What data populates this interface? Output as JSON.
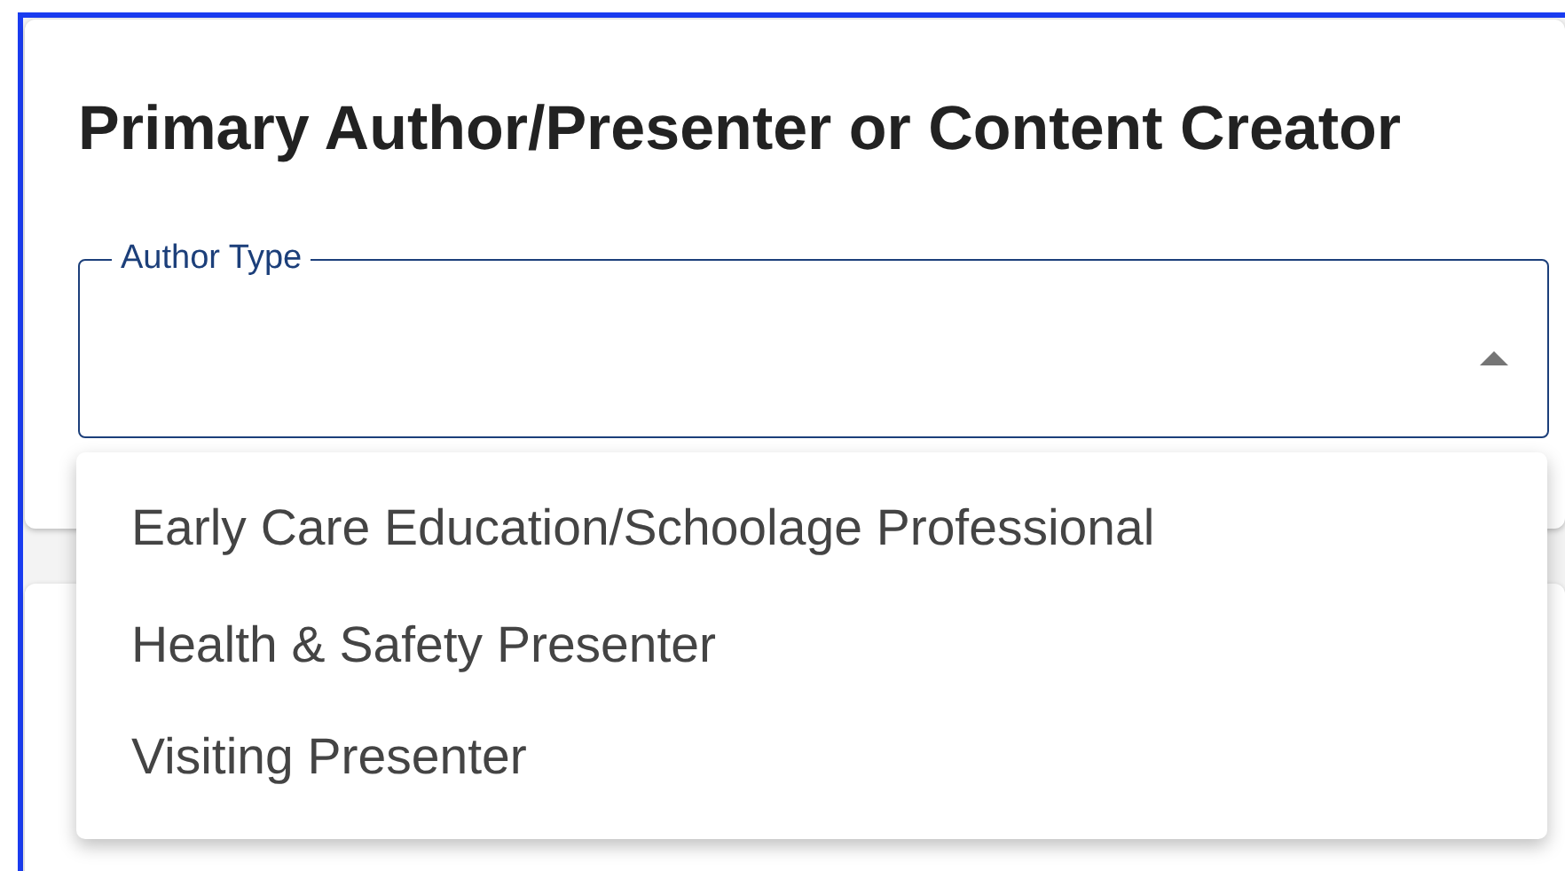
{
  "section": {
    "title": "Primary Author/Presenter or Content Creator"
  },
  "author_type": {
    "label": "Author Type",
    "expanded": true,
    "options": [
      {
        "label": "Early Care Education/Schoolage Professional"
      },
      {
        "label": "Health & Safety Presenter"
      },
      {
        "label": "Visiting Presenter"
      }
    ]
  }
}
